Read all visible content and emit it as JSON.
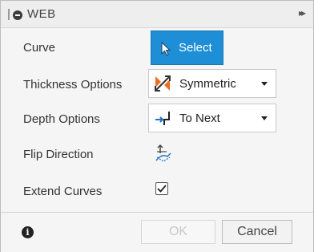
{
  "dialog": {
    "title": "WEB",
    "icons": {
      "collapse": "circle-minus-icon",
      "expand": "double-chevron-right-icon"
    }
  },
  "fields": {
    "curve": {
      "label": "Curve",
      "button_label": "Select",
      "button_icon": "cursor-arrow-icon",
      "button_color": "#1e8ed6"
    },
    "thickness": {
      "label": "Thickness Options",
      "value": "Symmetric",
      "icon": "symmetric-thickness-icon"
    },
    "depth": {
      "label": "Depth Options",
      "value": "To Next",
      "icon": "to-next-icon"
    },
    "flip": {
      "label": "Flip Direction",
      "icon": "flip-direction-icon"
    },
    "extend": {
      "label": "Extend Curves",
      "checked": true
    }
  },
  "footer": {
    "info_icon": "info-icon",
    "ok_label": "OK",
    "ok_enabled": false,
    "cancel_label": "Cancel"
  }
}
